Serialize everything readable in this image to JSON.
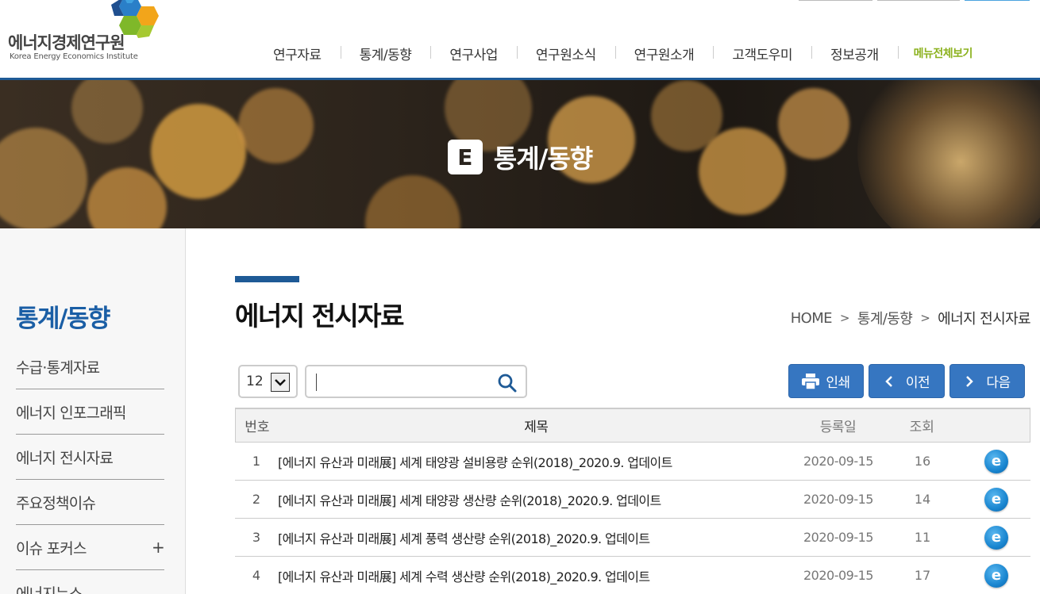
{
  "logo": {
    "name_ko": "에너지경제연구원",
    "name_en": "Korea Energy Economics Institute"
  },
  "gnb": {
    "items": [
      "연구자료",
      "통계/동향",
      "연구사업",
      "연구원소식",
      "연구원소개",
      "고객도우미",
      "정보공개"
    ],
    "all_menu": "메뉴전체보기"
  },
  "banner": {
    "badge": "E",
    "title": "통계/동향"
  },
  "sidebar": {
    "title": "통계/동향",
    "items": [
      {
        "label": "수급·통계자료"
      },
      {
        "label": "에너지 인포그래픽"
      },
      {
        "label": "에너지 전시자료"
      },
      {
        "label": "주요정책이슈"
      },
      {
        "label": "이슈 포커스",
        "expand": "+"
      },
      {
        "label": "에너지뉴스"
      }
    ]
  },
  "page": {
    "title": "에너지 전시자료"
  },
  "breadcrumb": {
    "home": "HOME",
    "sep": ">",
    "level1": "통계/동향",
    "current": "에너지 전시자료"
  },
  "controls": {
    "page_size": "12",
    "search_value": "",
    "print": "인쇄",
    "prev": "이전",
    "next": "다음"
  },
  "table": {
    "headers": {
      "num": "번호",
      "title": "제목",
      "date": "등록일",
      "views": "조회"
    },
    "rows": [
      {
        "num": "1",
        "title": "[에너지 유산과 미래展] 세계 태양광 설비용량 순위(2018)_2020.9. 업데이트",
        "date": "2020-09-15",
        "views": "16",
        "icon": "e"
      },
      {
        "num": "2",
        "title": "[에너지 유산과 미래展] 세계 태양광 생산량 순위(2018)_2020.9. 업데이트",
        "date": "2020-09-15",
        "views": "14",
        "icon": "e"
      },
      {
        "num": "3",
        "title": "[에너지 유산과 미래展] 세계 풍력 생산량 순위(2018)_2020.9. 업데이트",
        "date": "2020-09-15",
        "views": "11",
        "icon": "e"
      },
      {
        "num": "4",
        "title": "[에너지 유산과 미래展] 세계 수력 생산량 순위(2018)_2020.9. 업데이트",
        "date": "2020-09-15",
        "views": "17",
        "icon": "e"
      }
    ]
  },
  "colors": {
    "primary": "#1e5a96",
    "button": "#3676c1",
    "accent_green": "#8cb21f",
    "sidebar_title": "#1a5ea5"
  }
}
